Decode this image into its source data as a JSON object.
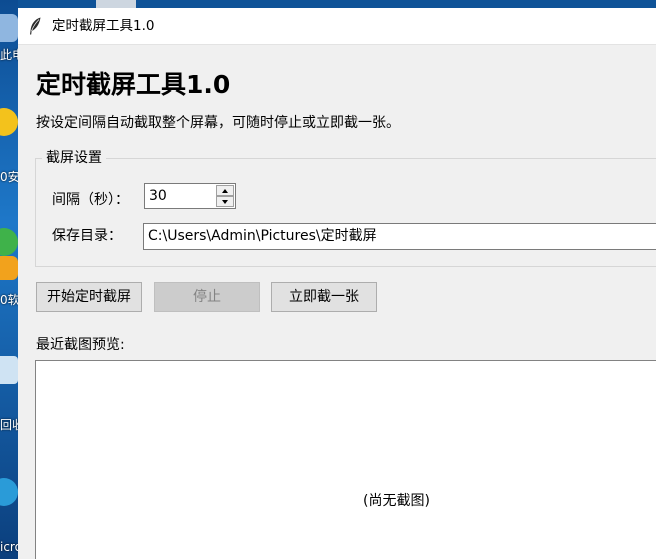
{
  "desktop": {
    "labels": [
      "此电",
      "0安",
      "0软",
      "回收",
      "icro"
    ]
  },
  "window": {
    "title": "定时截屏工具1.0",
    "icon": "feather-icon"
  },
  "app": {
    "heading": "定时截屏工具1.0",
    "description": "按设定间隔自动截取整个屏幕，可随时停止或立即截一张。"
  },
  "settings": {
    "group_title": "截屏设置",
    "interval_label": "间隔（秒）：",
    "interval_value": "30",
    "dir_label": "保存目录：",
    "dir_value": "C:\\Users\\Admin\\Pictures\\定时截屏"
  },
  "buttons": {
    "start": "开始定时截屏",
    "stop": "停止",
    "capture_now": "立即截一张"
  },
  "preview": {
    "label": "最近截图预览:",
    "empty_text": "(尚无截图)"
  }
}
